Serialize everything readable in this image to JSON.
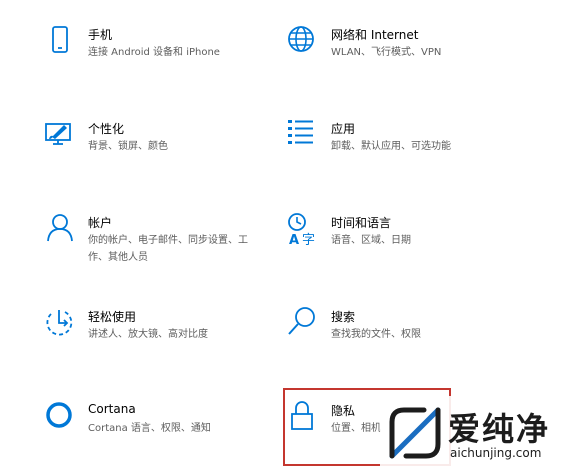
{
  "tiles": [
    {
      "icon": "phone-icon",
      "title": "手机",
      "desc": "连接 Android 设备和 iPhone"
    },
    {
      "icon": "globe-icon",
      "title": "网络和 Internet",
      "desc": "WLAN、飞行模式、VPN"
    },
    {
      "icon": "personalization-icon",
      "title": "个性化",
      "desc": "背景、锁屏、颜色"
    },
    {
      "icon": "apps-list-icon",
      "title": "应用",
      "desc": "卸载、默认应用、可选功能"
    },
    {
      "icon": "person-icon",
      "title": "帐户",
      "desc": "你的帐户、电子邮件、同步设置、工作、其他人员"
    },
    {
      "icon": "time-language-icon",
      "title": "时间和语言",
      "desc": "语音、区域、日期"
    },
    {
      "icon": "ease-of-access-icon",
      "title": "轻松使用",
      "desc": "讲述人、放大镜、高对比度"
    },
    {
      "icon": "search-icon",
      "title": "搜索",
      "desc": "查找我的文件、权限"
    },
    {
      "icon": "cortana-icon",
      "title": "Cortana",
      "desc": "Cortana 语言、权限、通知"
    },
    {
      "icon": "lock-icon",
      "title": "隐私",
      "desc": "位置、相机"
    }
  ],
  "colors": {
    "accent": "#0078d7",
    "highlight": "#c4362f"
  },
  "watermark": {
    "title": "爱纯净",
    "url": "aichunjing.com"
  }
}
